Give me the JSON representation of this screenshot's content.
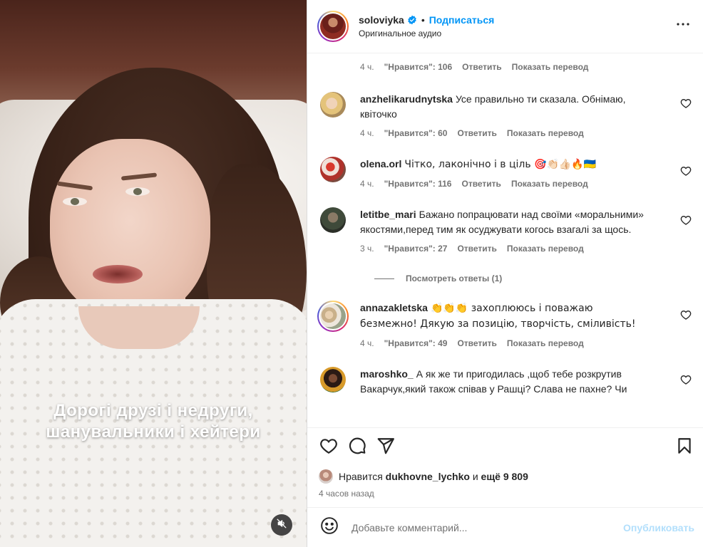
{
  "video": {
    "caption_line1": "Дорогі друзі і недруги,",
    "caption_line2": "шанувальники і хейтери",
    "mute_icon": "speaker-muted-icon"
  },
  "header": {
    "username": "soloviyka",
    "verified_icon": "verified-badge-icon",
    "dot": "•",
    "follow_label": "Подписаться",
    "audio_label": "Оригинальное аудио",
    "more_icon": "more-horizontal-icon"
  },
  "top_meta": {
    "time": "4 ч.",
    "likes": "\"Нравится\": 106",
    "reply": "Ответить",
    "translate": "Показать перевод"
  },
  "comments": [
    {
      "username": "anzhelikarudnytska",
      "text": "Усе правильно ти сказала. Обнімаю, квіточко",
      "time": "4 ч.",
      "likes": "\"Нравится\": 60",
      "reply": "Ответить",
      "translate": "Показать перевод"
    },
    {
      "username": "olena.orl",
      "text": "Чітко, лаконічно і в ціль 🎯👏🏻👍🏻🔥🇺🇦",
      "time": "4 ч.",
      "likes": "\"Нравится\": 116",
      "reply": "Ответить",
      "translate": "Показать перевод"
    },
    {
      "username": "letitbe_mari",
      "text": "Бажано попрацювати над своїми «моральними» якостями,перед тим як осуджувати когось взагалі за щось.",
      "time": "3 ч.",
      "likes": "\"Нравится\": 27",
      "reply": "Ответить",
      "translate": "Показать перевод"
    },
    {
      "username": "annazakletska",
      "text": "👏👏👏 захоплююсь і поважаю безмежно! Дякую за позицію, творчість, сміливість!",
      "time": "4 ч.",
      "likes": "\"Нравится\": 49",
      "reply": "Ответить",
      "translate": "Показать перевод"
    },
    {
      "username": "maroshko_",
      "text": "А як же ти пригодилась ,щоб тебе розкрутив Вакарчук,який також співав у Рашці? Слава не пахне? Чи"
    }
  ],
  "view_replies": "Посмотреть ответы (1)",
  "actions": {
    "like_icon": "heart-icon",
    "comment_icon": "comment-icon",
    "share_icon": "send-icon",
    "save_icon": "bookmark-icon"
  },
  "likes_line": {
    "prefix": "Нравится",
    "user": "dukhovne_lychko",
    "middle": "и",
    "rest": "ещё 9 809"
  },
  "posted_time": "4 часов назад",
  "compose": {
    "emoji_icon": "smiley-icon",
    "placeholder": "Добавьте комментарий...",
    "publish_label": "Опубликовать"
  },
  "colors": {
    "accent": "#0095f6",
    "publish_disabled": "#b2dffc",
    "muted_text": "#737373"
  }
}
